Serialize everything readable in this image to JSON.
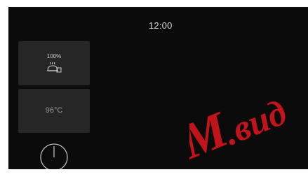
{
  "status_bar": {
    "time": "12:00"
  },
  "tiles": {
    "steam": {
      "level": "100%",
      "icon": "steam-dish-icon"
    },
    "temperature": {
      "value": "96°C"
    }
  },
  "controls": {
    "power_icon": "power-icon"
  },
  "watermark": {
    "text": "M.вид"
  },
  "colors": {
    "background": "#0b0b0b",
    "tile": "#262626",
    "text": "#d8d8d8",
    "watermark": "#c0141a"
  }
}
